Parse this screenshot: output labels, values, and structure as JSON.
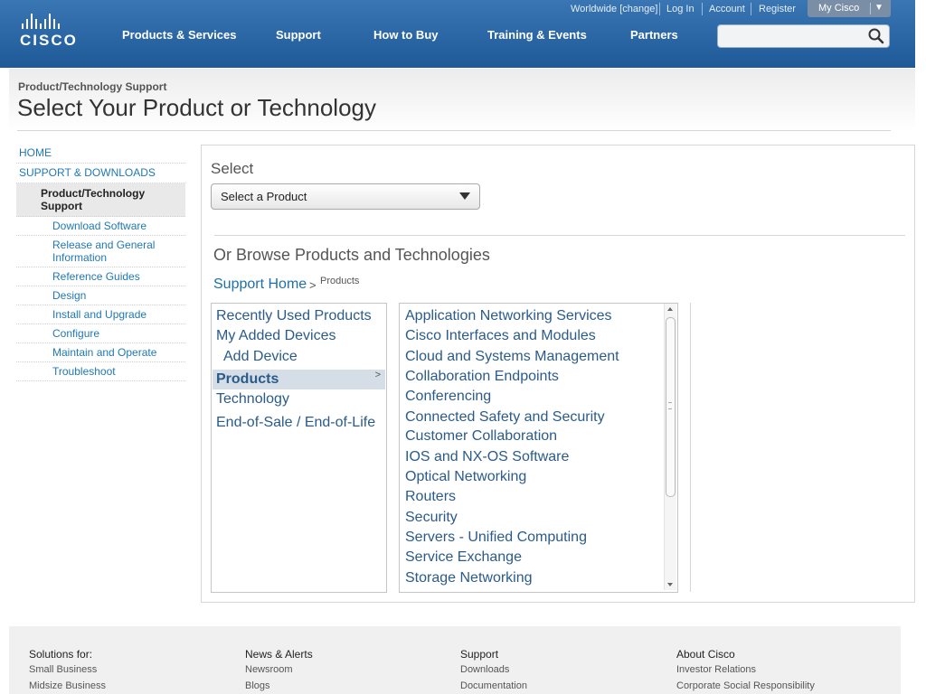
{
  "header": {
    "logo_text": "CISCO",
    "nav": [
      "Products & Services",
      "Support",
      "How to Buy",
      "Training & Events",
      "Partners"
    ],
    "utility": {
      "worldwide": "Worldwide [change]",
      "login": "Log In",
      "account": "Account",
      "register": "Register",
      "mycisco": "My Cisco"
    },
    "search_placeholder": ""
  },
  "page": {
    "breadcrumb": "Product/Technology Support",
    "title": "Select Your Product or Technology"
  },
  "leftnav": {
    "home": "HOME",
    "support": "SUPPORT & DOWNLOADS",
    "selected": "Product/Technology Support",
    "items": [
      "Download Software",
      "Release and General Information",
      "Reference Guides",
      "Design",
      "Install and Upgrade",
      "Configure",
      "Maintain and Operate",
      "Troubleshoot"
    ]
  },
  "main": {
    "select_label": "Select",
    "select_value": "Select a Product",
    "browse_title": "Or Browse Products and Technologies",
    "bc_home": "Support Home",
    "bc_sep": ">",
    "bc_current": "Products",
    "col1": {
      "recent": "Recently Used Products",
      "added": "My Added Devices",
      "add_device": "Add Device",
      "products": "Products",
      "products_chevron": ">",
      "technology": "Technology",
      "eol": "End-of-Sale / End-of-Life"
    },
    "col2": [
      "Application Networking Services",
      "Cisco Interfaces and Modules",
      "Cloud and Systems Management",
      "Collaboration Endpoints",
      "Conferencing",
      "Connected Safety and Security",
      "Customer Collaboration",
      "IOS and NX-OS Software",
      "Optical Networking",
      "Routers",
      "Security",
      "Servers - Unified Computing",
      "Service Exchange",
      "Storage Networking"
    ]
  },
  "footer": {
    "columns": [
      {
        "heading": "Solutions for:",
        "links": [
          "Small Business",
          "Midsize Business"
        ]
      },
      {
        "heading": "News & Alerts",
        "links": [
          "Newsroom",
          "Blogs"
        ]
      },
      {
        "heading": "Support",
        "links": [
          "Downloads",
          "Documentation"
        ]
      },
      {
        "heading": "About Cisco",
        "links": [
          "Investor Relations",
          "Corporate Social Responsibility"
        ]
      }
    ]
  },
  "colors": {
    "header_top": "#3a76b3",
    "header_bottom": "#1f5a98",
    "link_blue": "#1f78b4",
    "list_blue": "#2a5b8a",
    "selected_bg": "#d5dde6"
  }
}
